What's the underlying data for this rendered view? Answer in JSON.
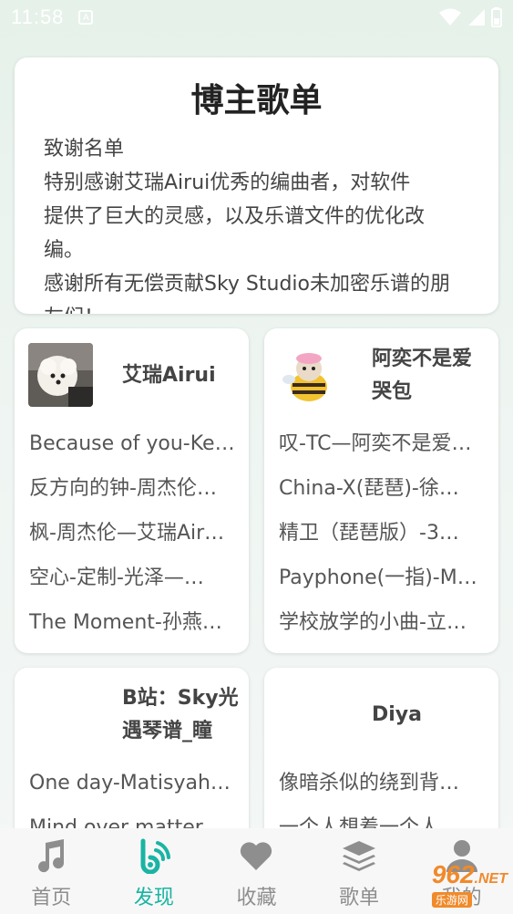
{
  "status_bar": {
    "time": "11:58",
    "a_badge": "A"
  },
  "intro": {
    "title": "博主歌单",
    "lines": [
      "致谢名单",
      "特别感谢艾瑞Airui优秀的编曲者，对软件",
      "提供了巨大的灵感，以及乐谱文件的优化改",
      "编。",
      "感谢所有无偿贡献Sky Studio未加密乐谱的朋",
      "友们！"
    ]
  },
  "playlists": [
    {
      "name": "艾瑞Airui",
      "songs": [
        "Because of you-Ke…",
        "反方向的钟-周杰伦…",
        "枫-周杰伦—艾瑞Air…",
        "空心-定制-光泽—…",
        "The Moment-孙燕…"
      ]
    },
    {
      "name_line1": "阿奕不是爱",
      "name_line2": "哭包",
      "songs": [
        "叹-TC—阿奕不是爱…",
        "China-X(琵琶)-徐…",
        "精卫（琵琶版）-3…",
        "Payphone(一指)-M…",
        "学校放学的小曲-立…"
      ]
    },
    {
      "name_line1": "B站：Sky光",
      "name_line2": "遇琴谱_瞳",
      "songs": [
        "One day-Matisyah…",
        "Mind over matter…"
      ]
    },
    {
      "name": "Diya",
      "songs": [
        "像暗杀似的绕到背…",
        "一个人想着一个人…"
      ]
    }
  ],
  "tabs": [
    {
      "label": "首页",
      "icon": "music-note-icon"
    },
    {
      "label": "发现",
      "icon": "discover-icon",
      "active": true
    },
    {
      "label": "收藏",
      "icon": "heart-icon"
    },
    {
      "label": "歌单",
      "icon": "layers-icon"
    },
    {
      "label": "我的",
      "icon": "person-icon"
    }
  ],
  "watermark": {
    "num": "962",
    "net": ".NET",
    "sub": "乐游网"
  },
  "colors": {
    "accent": "#19b4a4",
    "tab_inactive": "#8e8e8e"
  }
}
